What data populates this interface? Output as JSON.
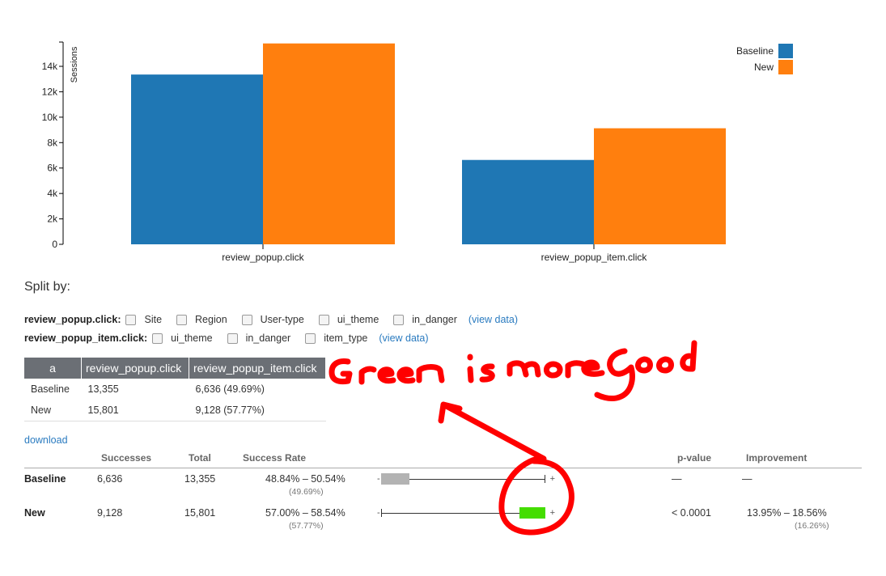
{
  "chart_data": {
    "type": "bar",
    "title": "",
    "xlabel": "",
    "ylabel": "Sessions",
    "ylim": [
      0,
      16000
    ],
    "yticks": [
      0,
      2000,
      4000,
      6000,
      8000,
      10000,
      12000,
      14000
    ],
    "ytick_labels": [
      "0",
      "2k",
      "4k",
      "6k",
      "8k",
      "10k",
      "12k",
      "14k"
    ],
    "categories": [
      "review_popup.click",
      "review_popup_item.click"
    ],
    "series": [
      {
        "name": "Baseline",
        "color": "#1f77b4",
        "values": [
          13355,
          6636
        ]
      },
      {
        "name": "New",
        "color": "#ff7f0e",
        "values": [
          15801,
          9128
        ]
      }
    ],
    "legend": "top-right",
    "grid": false
  },
  "split": {
    "title": "Split by:",
    "rows": [
      {
        "label": "review_popup.click:",
        "options": [
          "Site",
          "Region",
          "User-type",
          "ui_theme",
          "in_danger"
        ],
        "link": "(view data)"
      },
      {
        "label": "review_popup_item.click:",
        "options": [
          "ui_theme",
          "in_danger",
          "item_type"
        ],
        "link": "(view data)"
      }
    ]
  },
  "summary_table": {
    "headers": [
      "a",
      "review_popup.click",
      "review_popup_item.click"
    ],
    "rows": [
      [
        "Baseline",
        "13,355",
        "6,636 (49.69%)"
      ],
      [
        "New",
        "15,801",
        "9,128 (57.77%)"
      ]
    ]
  },
  "download_label": "download",
  "results": {
    "headers": {
      "successes": "Successes",
      "total": "Total",
      "rate": "Success Rate",
      "pvalue": "p-value",
      "improvement": "Improvement"
    },
    "ci_axis": {
      "minus": "-",
      "plus": "+"
    },
    "rows": [
      {
        "name": "Baseline",
        "successes": "6,636",
        "total": "13,355",
        "rate_range": "48.84% – 50.54%",
        "rate_point": "(49.69%)",
        "pvalue": "—",
        "improvement": "—",
        "improvement_point": "",
        "box_color": "#b3b3b3",
        "box_range": [
          0.0,
          0.17
        ]
      },
      {
        "name": "New",
        "successes": "9,128",
        "total": "15,801",
        "rate_range": "57.00% – 58.54%",
        "rate_point": "(57.77%)",
        "pvalue": "< 0.0001",
        "improvement": "13.95% – 18.56%",
        "improvement_point": "(16.26%)",
        "box_color": "#44dd00",
        "box_range": [
          0.84,
          1.0
        ]
      }
    ]
  },
  "annotation": {
    "text": "Green is more good",
    "color": "#ff0000"
  }
}
